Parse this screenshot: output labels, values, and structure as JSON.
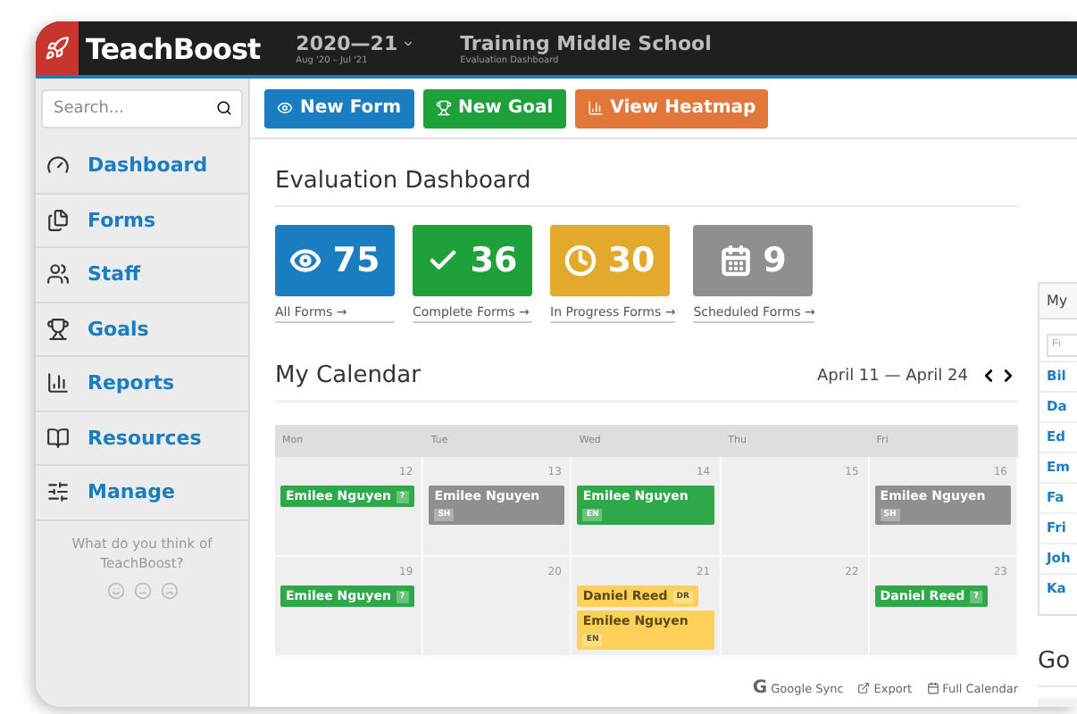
{
  "header": {
    "brand": "TeachBoost",
    "year": "2020—21",
    "year_range": "Aug '20 – Jul '21",
    "school": "Training Middle School",
    "subtitle": "Evaluation Dashboard"
  },
  "sidebar": {
    "search_placeholder": "Search...",
    "items": [
      {
        "label": "Dashboard"
      },
      {
        "label": "Forms"
      },
      {
        "label": "Staff"
      },
      {
        "label": "Goals"
      },
      {
        "label": "Reports"
      },
      {
        "label": "Resources"
      },
      {
        "label": "Manage"
      }
    ],
    "feedback": "What do you think of TeachBoost?"
  },
  "toolbar": [
    {
      "label": "New Form",
      "color": "#1b7dc1"
    },
    {
      "label": "New Goal",
      "color": "#1ea03a"
    },
    {
      "label": "View Heatmap",
      "color": "#e1783a"
    }
  ],
  "page_title": "Evaluation Dashboard",
  "stats": [
    {
      "value": "75",
      "label": "All Forms →",
      "color": "#1b7dc1"
    },
    {
      "value": "36",
      "label": "Complete Forms →",
      "color": "#1ea03a"
    },
    {
      "value": "30",
      "label": "In Progress Forms →",
      "color": "#e2a92c"
    },
    {
      "value": "9",
      "label": "Scheduled Forms →",
      "color": "#8f8f8f"
    }
  ],
  "calendar": {
    "title": "My Calendar",
    "range": "April 11 — April 24",
    "days": [
      "Mon",
      "Tue",
      "Wed",
      "Thu",
      "Fri"
    ],
    "weeks": [
      [
        {
          "date": "12",
          "events": [
            {
              "name": "Emilee Nguyen",
              "tag": "?",
              "kind": "chip",
              "color": "#2ea84a"
            }
          ]
        },
        {
          "date": "13",
          "events": [
            {
              "name": "Emilee Nguyen",
              "tag": "SH",
              "kind": "block",
              "color": "#8f8f8f"
            }
          ]
        },
        {
          "date": "14",
          "events": [
            {
              "name": "Emilee Nguyen",
              "tag": "EN",
              "kind": "block",
              "color": "#2ea84a"
            }
          ]
        },
        {
          "date": "15"
        },
        {
          "date": "16",
          "events": [
            {
              "name": "Emilee Nguyen",
              "tag": "SH",
              "kind": "block",
              "color": "#8f8f8f"
            }
          ]
        }
      ],
      [
        {
          "date": "19",
          "events": [
            {
              "name": "Emilee Nguyen",
              "tag": "?",
              "kind": "chip",
              "color": "#2ea84a"
            }
          ]
        },
        {
          "date": "20"
        },
        {
          "date": "21",
          "events": [
            {
              "name": "Daniel Reed",
              "tag": "DR",
              "kind": "chip",
              "color": "#fcd15a"
            },
            {
              "name": "Emilee Nguyen",
              "tag": "EN",
              "kind": "block",
              "color": "#fcd15a"
            }
          ]
        },
        {
          "date": "22"
        },
        {
          "date": "23",
          "events": [
            {
              "name": "Daniel Reed",
              "tag": "?",
              "kind": "chip",
              "color": "#2ea84a"
            }
          ]
        }
      ]
    ],
    "links": [
      {
        "label": "Google Sync",
        "glyph": "G"
      },
      {
        "label": "Export"
      },
      {
        "label": "Full Calendar"
      }
    ]
  },
  "right_panel": {
    "title": "My",
    "filter_placeholder": "Fi",
    "names": [
      "Bil",
      "Da",
      "Ed",
      "Em",
      "Fa",
      "Fri",
      "Joh",
      "Ka"
    ],
    "section": "Go"
  }
}
